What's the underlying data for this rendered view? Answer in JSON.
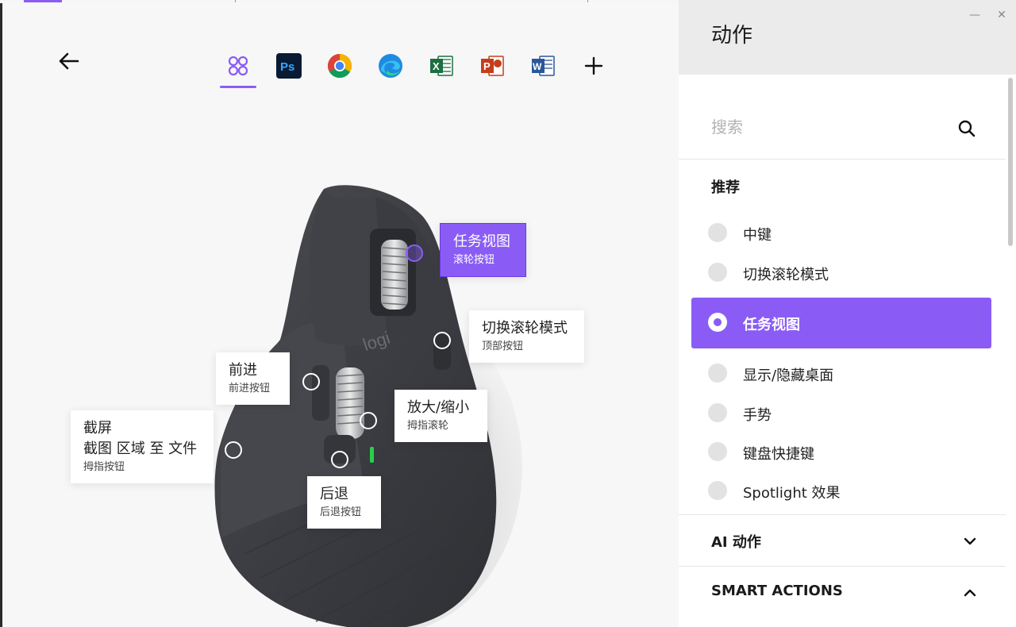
{
  "window": {
    "minimize_glyph": "—",
    "close_glyph": "✕"
  },
  "header": {
    "apps": [
      {
        "name": "all-apps",
        "label": "全部应用",
        "active": true
      },
      {
        "name": "photoshop",
        "label": "Ps"
      },
      {
        "name": "chrome",
        "label": "Chrome"
      },
      {
        "name": "edge",
        "label": "Edge"
      },
      {
        "name": "excel",
        "label": "X"
      },
      {
        "name": "powerpoint",
        "label": "P"
      },
      {
        "name": "word",
        "label": "W"
      }
    ],
    "add_glyph": "+"
  },
  "mouse": {
    "brand_text": "logi",
    "callouts": {
      "task_view": {
        "title": "任务视图",
        "subtitle": "滚轮按钮"
      },
      "wheel_mode": {
        "title": "切换滚轮模式",
        "subtitle": "顶部按钮"
      },
      "forward": {
        "title": "前进",
        "subtitle": "前进按钮"
      },
      "zoom": {
        "title": "放大/缩小",
        "subtitle": "拇指滚轮"
      },
      "screenshot": {
        "title": "截屏",
        "title2": "截图 区域 至 文件",
        "subtitle": "拇指按钮"
      },
      "back": {
        "title": "后退",
        "subtitle": "后退按钮"
      }
    }
  },
  "panel": {
    "title": "动作",
    "search": {
      "placeholder": "搜索",
      "value": ""
    },
    "recommended_label": "推荐",
    "actions": [
      {
        "label": "中键",
        "selected": false
      },
      {
        "label": "切换滚轮模式",
        "selected": false
      },
      {
        "label": "任务视图",
        "selected": true
      },
      {
        "label": "显示/隐藏桌面",
        "selected": false
      },
      {
        "label": "手势",
        "selected": false
      },
      {
        "label": "键盘快捷键",
        "selected": false
      },
      {
        "label": "Spotlight 效果",
        "selected": false
      }
    ],
    "sections": [
      {
        "label": "AI 动作",
        "expanded": false
      },
      {
        "label": "SMART ACTIONS",
        "expanded": true
      }
    ]
  },
  "colors": {
    "accent": "#8a5cf5",
    "mouse_body": "#3a3c40",
    "panel_header": "#ebebeb"
  }
}
